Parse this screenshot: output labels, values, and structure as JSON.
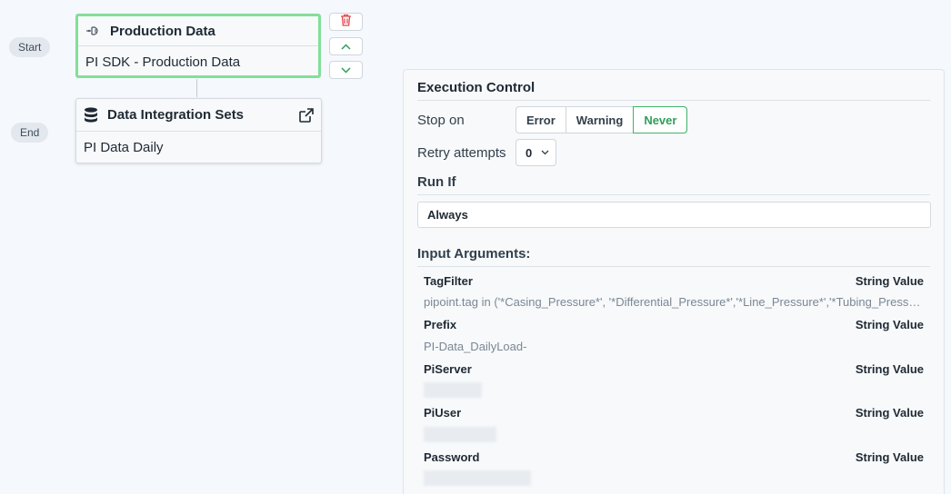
{
  "flow": {
    "start_label": "Start",
    "end_label": "End",
    "nodes": [
      {
        "title": "Production Data",
        "subtitle": "PI SDK - Production Data",
        "icon": "plug-icon"
      },
      {
        "title": "Data Integration Sets",
        "subtitle": "PI Data Daily",
        "icon": "database-icon"
      }
    ]
  },
  "panel": {
    "title": "Execution Control",
    "stop_on_label": "Stop on",
    "stop_on_options": [
      "Error",
      "Warning",
      "Never"
    ],
    "stop_on_selected": "Never",
    "retry_label": "Retry attempts",
    "retry_value": "0",
    "run_if_label": "Run If",
    "run_if_value": "Always",
    "input_args_label": "Input Arguments:",
    "args": [
      {
        "name": "TagFilter",
        "type": "String Value",
        "value": "pipoint.tag in ('*Casing_Pressure*', '*Differential_Pressure*','*Line_Pressure*','*Tubing_Pressure*')"
      },
      {
        "name": "Prefix",
        "type": "String Value",
        "value": "PI-Data_DailyLoad-"
      },
      {
        "name": "PiServer",
        "type": "String Value",
        "value": ""
      },
      {
        "name": "PiUser",
        "type": "String Value",
        "value": ""
      },
      {
        "name": "Password",
        "type": "String Value",
        "value": ""
      }
    ]
  },
  "colors": {
    "accent_green": "#3fb36a",
    "selected_border": "#82df9a",
    "delete_red": "#e5484d"
  }
}
